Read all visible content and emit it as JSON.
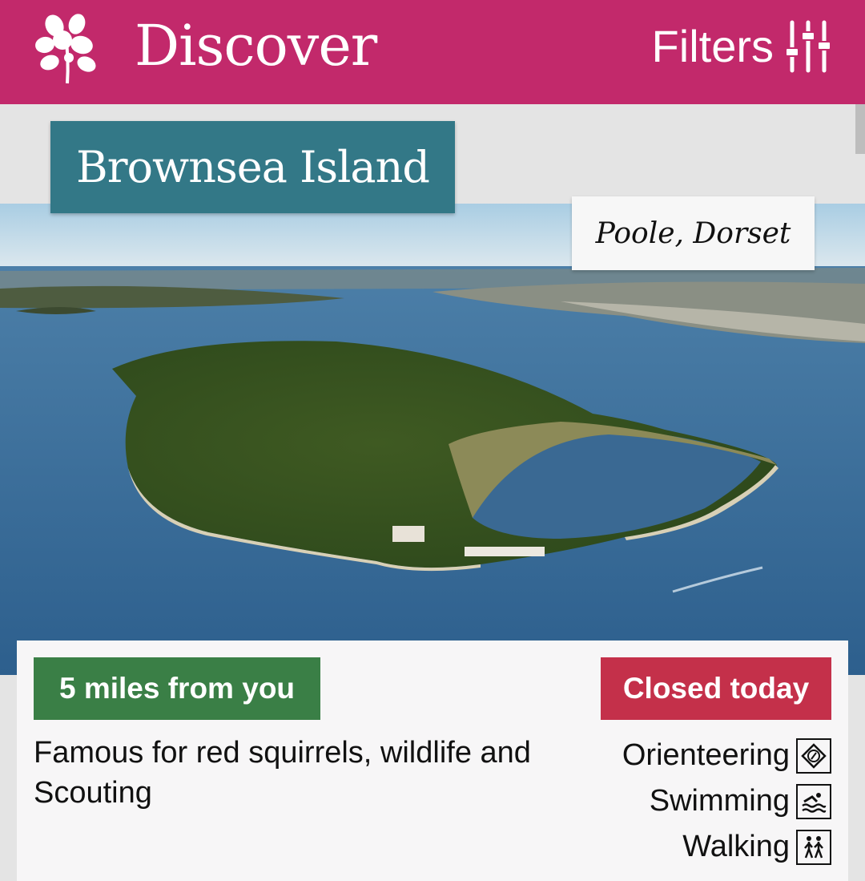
{
  "header": {
    "logo_icon": "oak-leaf-icon",
    "title": "Discover",
    "filters_label": "Filters",
    "filters_icon": "sliders-icon",
    "background_color": "#c2296b"
  },
  "place": {
    "name": "Brownsea Island",
    "location": "Poole, Dorset",
    "image_icon": "aerial-island-photo",
    "distance": "5 miles from you",
    "status": "Closed today",
    "description": "Famous for red squirrels, wildlife and Scouting",
    "activities": [
      {
        "label": "Orienteering",
        "icon": "compass-icon"
      },
      {
        "label": "Swimming",
        "icon": "swimmer-icon"
      },
      {
        "label": "Walking",
        "icon": "walkers-icon"
      }
    ]
  },
  "colors": {
    "name_box": "#337887",
    "distance_badge": "#3a7f46",
    "status_badge": "#c4304a"
  }
}
